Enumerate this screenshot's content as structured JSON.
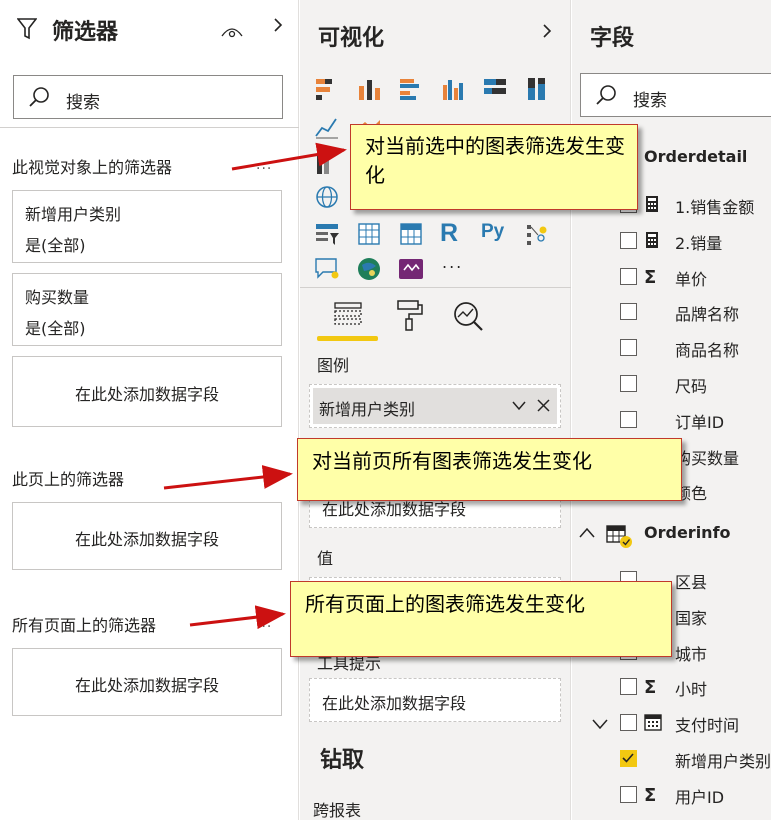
{
  "filters": {
    "title": "筛选器",
    "search_placeholder": "搜索",
    "visual_section": "此视觉对象上的筛选器",
    "cards": [
      {
        "field": "新增用户类别",
        "value": "是(全部)"
      },
      {
        "field": "购买数量",
        "value": "是(全部)"
      }
    ],
    "add_field": "在此处添加数据字段",
    "page_section": "此页上的筛选器",
    "all_pages_section": "所有页面上的筛选器",
    "more": "..."
  },
  "viz": {
    "title": "可视化",
    "more_visuals": "...",
    "legend_label": "图例",
    "legend_chip": "新增用户类别",
    "values_label": "值",
    "tooltip_label": "工具提示",
    "add_field": "在此处添加数据字段",
    "drill_label": "钻取",
    "cross_report": "跨报表"
  },
  "fields": {
    "title": "字段",
    "search_placeholder": "搜索",
    "tables": [
      {
        "name": "Orderdetail",
        "items": [
          {
            "label": "1.销售金额",
            "icon": "calculator-icon",
            "checked": false
          },
          {
            "label": "2.销量",
            "icon": "calculator-icon",
            "checked": false
          },
          {
            "label": "单价",
            "icon": "sigma-icon",
            "checked": false
          },
          {
            "label": "品牌名称",
            "icon": "",
            "checked": false
          },
          {
            "label": "商品名称",
            "icon": "",
            "checked": false
          },
          {
            "label": "尺码",
            "icon": "",
            "checked": false
          },
          {
            "label": "订单ID",
            "icon": "",
            "checked": false
          },
          {
            "label": "购买数量",
            "icon": "",
            "checked": false
          },
          {
            "label": "颜色",
            "icon": "",
            "checked": false
          }
        ]
      },
      {
        "name": "Orderinfo",
        "items": [
          {
            "label": "区县",
            "icon": "",
            "checked": false
          },
          {
            "label": "国家",
            "icon": "",
            "checked": false
          },
          {
            "label": "城市",
            "icon": "",
            "checked": false
          },
          {
            "label": "小时",
            "icon": "sigma-icon",
            "checked": false
          },
          {
            "label": "支付时间",
            "icon": "calendar-icon",
            "checked": false
          },
          {
            "label": "新增用户类别",
            "icon": "",
            "checked": true
          },
          {
            "label": "用户ID",
            "icon": "sigma-icon",
            "checked": false
          }
        ]
      }
    ]
  },
  "annotations": {
    "visual": "对当前选中的图表筛选发生变化",
    "page": "对当前页所有图表筛选发生变化",
    "all_pages": "所有页面上的图表筛选发生变化"
  },
  "colors": {
    "accent": "#f2c811",
    "callout_bg": "#ffffa8",
    "callout_border": "#c0392b",
    "arrow": "#cc1111"
  }
}
